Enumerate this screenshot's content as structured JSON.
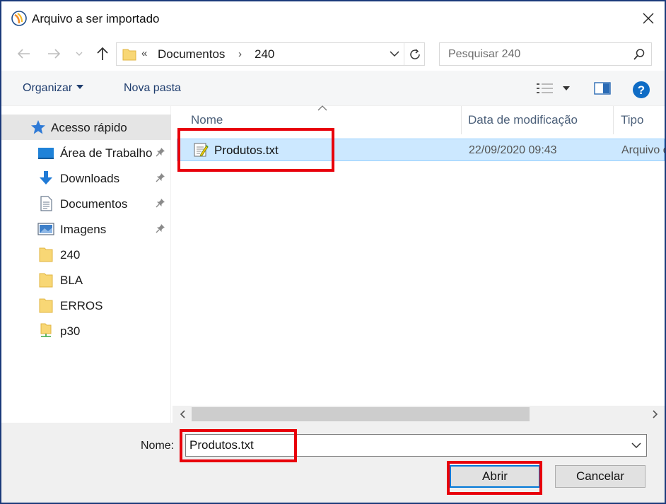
{
  "window": {
    "title": "Arquivo a ser importado"
  },
  "address": {
    "overflow_glyph": "«",
    "segments": [
      "Documentos",
      "240"
    ],
    "separator": "›"
  },
  "search": {
    "placeholder": "Pesquisar 240"
  },
  "toolbar": {
    "organize_label": "Organizar",
    "new_folder_label": "Nova pasta"
  },
  "sidebar": {
    "items": [
      {
        "label": "Acesso rápido",
        "icon": "star-icon",
        "pinned": false
      },
      {
        "label": "Área de Trabalho",
        "icon": "desktop-icon",
        "pinned": true
      },
      {
        "label": "Downloads",
        "icon": "download-arrow-icon",
        "pinned": true
      },
      {
        "label": "Documentos",
        "icon": "document-icon",
        "pinned": true
      },
      {
        "label": "Imagens",
        "icon": "pictures-icon",
        "pinned": true
      },
      {
        "label": "240",
        "icon": "folder-icon",
        "pinned": false
      },
      {
        "label": "BLA",
        "icon": "folder-icon",
        "pinned": false
      },
      {
        "label": "ERROS",
        "icon": "folder-icon",
        "pinned": false
      },
      {
        "label": "p30",
        "icon": "network-folder-icon",
        "pinned": false
      }
    ]
  },
  "filelist": {
    "columns": [
      "Nome",
      "Data de modificação",
      "Tipo"
    ],
    "rows": [
      {
        "name": "Produtos.txt",
        "modified": "22/09/2020 09:43",
        "type": "Arquivo de Texto",
        "icon": "text-file-icon",
        "selected": true
      }
    ]
  },
  "footer": {
    "name_label": "Nome:",
    "name_value": "Produtos.txt",
    "open_label": "Abrir",
    "cancel_label": "Cancelar"
  },
  "colors": {
    "accent": "#0078d7",
    "selection": "#cce8ff",
    "highlight": "#e8000b",
    "folder": "#f8d775"
  }
}
